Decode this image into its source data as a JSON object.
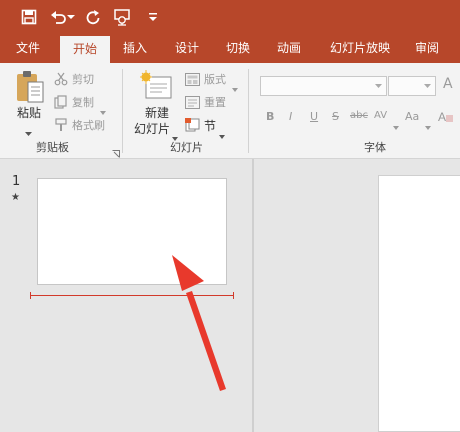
{
  "tabs": [
    "文件",
    "开始",
    "插入",
    "设计",
    "切换",
    "动画",
    "幻灯片放映",
    "审阅"
  ],
  "clipboard": {
    "paste_label": "粘贴",
    "cut_label": "剪切",
    "copy_label": "复制",
    "format_painter_label": "格式刷",
    "group_label": "剪贴板"
  },
  "slides_group": {
    "new_slide_line1": "新建",
    "new_slide_line2": "幻灯片",
    "layout_label": "版式",
    "reset_label": "重置",
    "section_label": "节",
    "group_label": "幻灯片"
  },
  "font_group": {
    "group_label": "字体",
    "bold": "B",
    "italic": "I",
    "underline": "U",
    "strike": "S",
    "strike_sub": "abc",
    "spacing_label": "AV",
    "case_label": "Aa",
    "grow_label": "A"
  },
  "slide_panel": {
    "slide_number": "1",
    "slide_star": "★"
  },
  "colors": {
    "accent": "#b7472a",
    "arrow": "#e8392c"
  }
}
